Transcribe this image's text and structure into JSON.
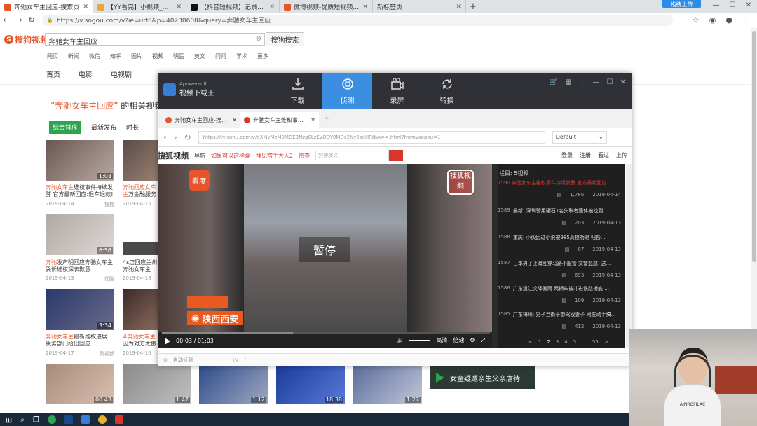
{
  "browser": {
    "tabs": [
      {
        "title": "奔驰女车主回应-搜索页",
        "color": "#e8542a",
        "active": true
      },
      {
        "title": "【YY看完】小视频_搞笑视频_短...",
        "color": "#e8a63a",
        "active": false
      },
      {
        "title": "【抖音短视频】记录美好生活-D...",
        "color": "#111111",
        "active": false
      },
      {
        "title": "微博视频-优质短视频，优质播放...",
        "color": "#e8542a",
        "active": false
      },
      {
        "title": "新标签页",
        "color": "#dddddd",
        "active": false
      }
    ],
    "url": "https://v.sogou.com/v?ie=utf8&p=40230608&query=奔驰女车主回应",
    "upload_label": "拖拽上传"
  },
  "sogou": {
    "logo": "搜狗视频",
    "query": "奔驰女车主回应",
    "search_button": "搜狗搜索",
    "verticals": [
      "网页",
      "新闻",
      "微信",
      "知乎",
      "图片",
      "视频",
      "明医",
      "英文",
      "问问",
      "学术",
      "更多"
    ],
    "subnav": [
      "首页",
      "电影",
      "电视剧"
    ],
    "related_query": "“奔驰女车主回应”",
    "related_suffix": "的相关视频",
    "sort": [
      "综合排序",
      "最新发布",
      "时长"
    ],
    "videos": [
      {
        "title_hl": "奔驰女车主",
        "title_rest": "维权事件持续发酵 官方最新回应:退车退款!",
        "date": "2019-04-14",
        "source": "搜狐",
        "dur": "1:03"
      },
      {
        "title_hl": "奔驰回应女车主",
        "title_rest": "万金融服务费",
        "date": "2019-04-15",
        "source": "",
        "dur": ""
      },
      {
        "title_hl": "奔驰",
        "title_rest": "发声明回应奔驰女车主哭诉维权深表歉意",
        "date": "2019-04-13",
        "source": "优酷",
        "dur": "6:56"
      },
      {
        "title_hl": "",
        "title_rest": "4s店回应兰州奔驰女车主 是车辆质量问题",
        "date": "2019-04-18",
        "source": "",
        "dur": ""
      },
      {
        "title_hl": "奔驰女车主",
        "title_rest": "最新维权进展 税务部门给出回应",
        "date": "2019-04-17",
        "source": "梨视频",
        "dur": "3:34"
      },
      {
        "title_hl": "#奔驰女车主",
        "title_rest": "因为对方太傲慢",
        "date": "2019-04-16",
        "source": "",
        "dur": ""
      }
    ],
    "bottom_durs": [
      "00:43",
      "1:47",
      "1:12",
      "18:38",
      "1:27"
    ],
    "ad_text": "女童疑遭亲生父亲虐待"
  },
  "apowersoft": {
    "brand": "Apowersoft",
    "name": "视频下载王",
    "tabs": [
      "下载",
      "侦测",
      "录屏",
      "转换"
    ],
    "browser_tabs": [
      "奔驰女车主回应-搜...",
      "奔驰女车主维权事..."
    ],
    "url": "https://tv.sohu.com/v/dXMvMzM0MDE3Nzg0LzEyODY0MDc2Ny5zaHRtbA==.html?fromvsogou=1",
    "default_label": "Default",
    "sohu": {
      "logo": "搜狐视频",
      "nav": "导航",
      "links": [
        "如果可以这样爱",
        "拜见宫主大人2",
        "密查"
      ],
      "search_placeholder": "封神演义",
      "right": [
        "登录",
        "注册",
        "看过",
        "上传"
      ]
    },
    "player": {
      "kandian": "看度",
      "sohu_badge": "搜狐视频",
      "pause": "暂停",
      "region": "陕西西安",
      "time": "00:03 / 01:03",
      "quality": "高清",
      "speed": "倍速"
    },
    "playlist": {
      "header": "栏目: 5视频",
      "items": [
        {
          "num": "",
          "title": "1590 奔驰女车主维权事件持续发酵 官方最新回应",
          "views": "1,786",
          "date": "2019-04-14",
          "active": true
        },
        {
          "num": "1589",
          "title": "最新! 深圳警用罐石1名失联者遗体被找到 ...",
          "views": "203",
          "date": "2019-04-13",
          "active": false
        },
        {
          "num": "1588",
          "title": "重庆: 小伙因过小说被985高校劝退 归咎...",
          "views": "87",
          "date": "2019-04-13",
          "active": false
        },
        {
          "num": "1587",
          "title": "日本男子上海乱穿马路不服管 交警怒怼: 这...",
          "views": "693",
          "date": "2019-04-13",
          "active": false
        },
        {
          "num": "1586",
          "title": "广东湛江突降暴雨 两辆车被冲进铁路桥底 ...",
          "views": "109",
          "date": "2019-04-13",
          "active": false
        },
        {
          "num": "1585",
          "title": "广东梅州: 男子当街于御驾殴妻子 网友动手搞...",
          "views": "412",
          "date": "2019-04-13",
          "active": false
        }
      ],
      "pager": [
        "<",
        "1",
        "2",
        "3",
        "4",
        "5",
        "...",
        "55",
        ">"
      ]
    },
    "footer": "自动侦测"
  },
  "webcam": {
    "shirt_text": "AINROFILAC"
  }
}
